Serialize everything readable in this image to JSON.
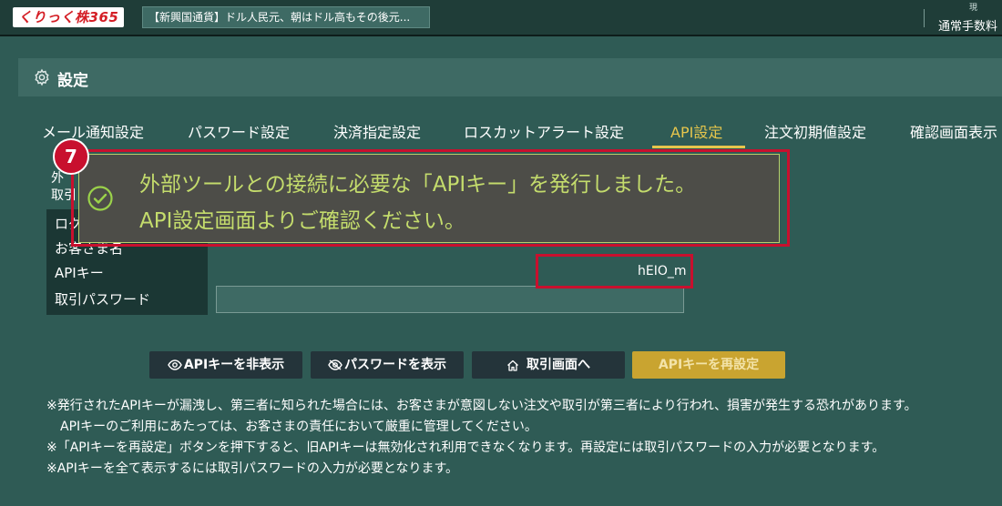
{
  "header": {
    "logo": "くりっく株365",
    "ticker": "【新興国通貨】ドル人民元、朝はドル高もその後元...",
    "top_right_small": "現",
    "top_right": "通常手数料"
  },
  "settings": {
    "title": "設定",
    "icon": "gear-icon"
  },
  "tabs": [
    {
      "label": "メール通知設定"
    },
    {
      "label": "パスワード設定"
    },
    {
      "label": "決済指定設定"
    },
    {
      "label": "ロスカットアラート設定"
    },
    {
      "label": "API設定",
      "active": true
    },
    {
      "label": "注文初期値設定"
    },
    {
      "label": "確認画面表示"
    }
  ],
  "partial_labels": {
    "line1": "外",
    "line2": "取引"
  },
  "info_table": {
    "rows": [
      {
        "label": "ログ"
      },
      {
        "label": "お客さま名"
      },
      {
        "label": "APIキー",
        "value": "hEIO_m"
      },
      {
        "label": "取引パスワード",
        "input_value": ""
      }
    ]
  },
  "toast": {
    "step": "7",
    "line1": "外部ツールとの接続に必要な「APIキー」を発行しました。",
    "line2": "API設定画面よりご確認ください。",
    "icon": "check-circle-icon",
    "text_color": "#c4dc6c"
  },
  "buttons": {
    "hide_api": "APIキーを非表示",
    "show_password": "パスワードを表示",
    "trade_screen": "取引画面へ",
    "reset_api": "APIキーを再設定"
  },
  "notes": [
    "※発行されたAPIキーが漏洩し、第三者に知られた場合には、お客さまが意図しない注文や取引が第三者により行われ、損害が発生する恐れがあります。",
    "APIキーのご利用にあたっては、お客さまの責任において厳重に管理してください。",
    "※「APIキーを再設定」ボタンを押下すると、旧APIキーは無効化され利用できなくなります。再設定には取引パスワードの入力が必要となります。",
    "※APIキーを全て表示するには取引パスワードの入力が必要となります。"
  ],
  "colors": {
    "background": "#2f5b55",
    "accent": "#e7c64c",
    "highlight": "#c8102e",
    "gold_button": "#c9a430"
  }
}
